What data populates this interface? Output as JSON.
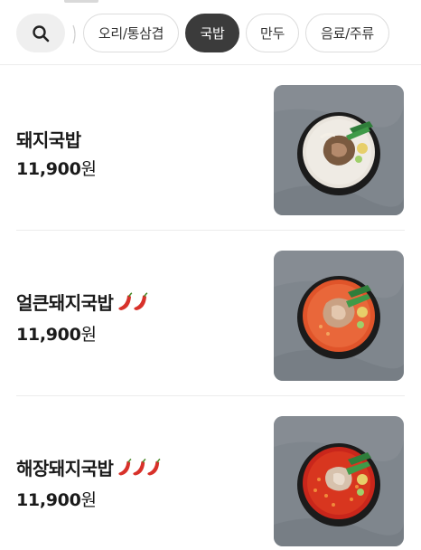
{
  "top_tabs": {
    "search_icon": "search-icon",
    "chips": [
      {
        "label": "오리/통삼겹",
        "active": false
      },
      {
        "label": "국밥",
        "active": true
      },
      {
        "label": "만두",
        "active": false
      },
      {
        "label": "음료/주류",
        "active": false
      }
    ]
  },
  "menu_items": [
    {
      "name": "돼지국밥",
      "price_number": "11,900",
      "price_unit": "원",
      "spice_level": 0,
      "soup": "white"
    },
    {
      "name": "얼큰돼지국밥",
      "price_number": "11,900",
      "price_unit": "원",
      "spice_level": 2,
      "soup": "red"
    },
    {
      "name": "해장돼지국밥",
      "price_number": "11,900",
      "price_unit": "원",
      "spice_level": 3,
      "soup": "deep-red"
    }
  ],
  "colors": {
    "active_chip": "#3b3b3b",
    "pepper": "#d8312a",
    "tray": "#7f868d"
  }
}
